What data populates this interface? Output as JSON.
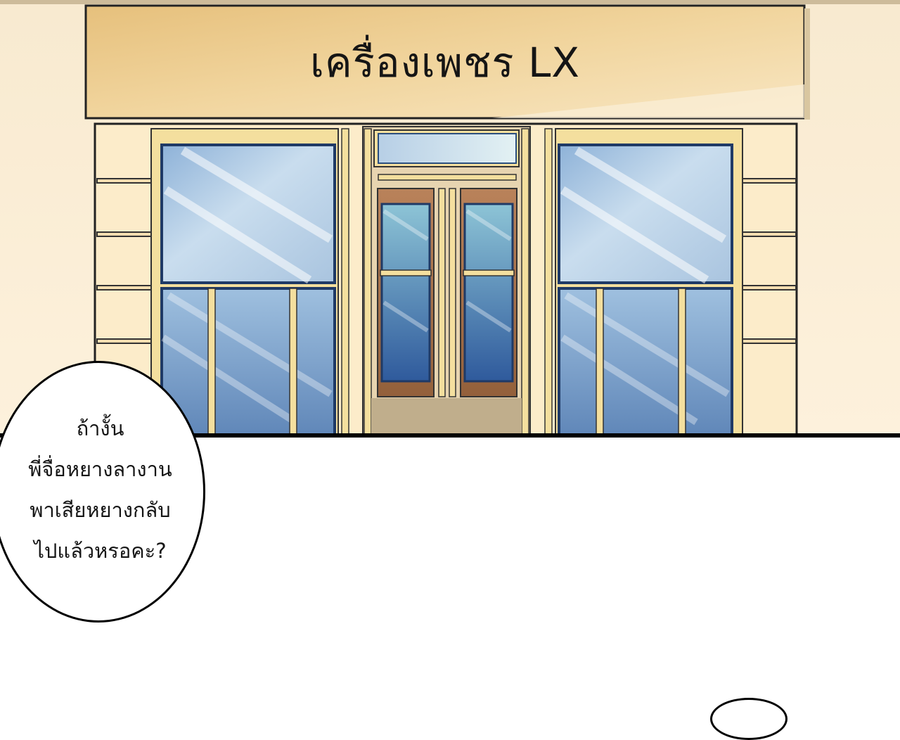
{
  "shop_sign": {
    "text": "เครื่องเพชร LX"
  },
  "speech_bubble": {
    "lines": [
      "ถ้างั้น",
      "พี่จื่อหยางลางาน",
      "พาเสียหยางกลับ",
      "ไปแล้วหรอคะ?"
    ]
  },
  "colors": {
    "wall": "#fcebc9",
    "sign": "#efcd8e",
    "frame": "#f5dd9c",
    "glass": "#9dbbd9",
    "door_wood": "#a56e45",
    "door_glass": "#3f66a8"
  }
}
